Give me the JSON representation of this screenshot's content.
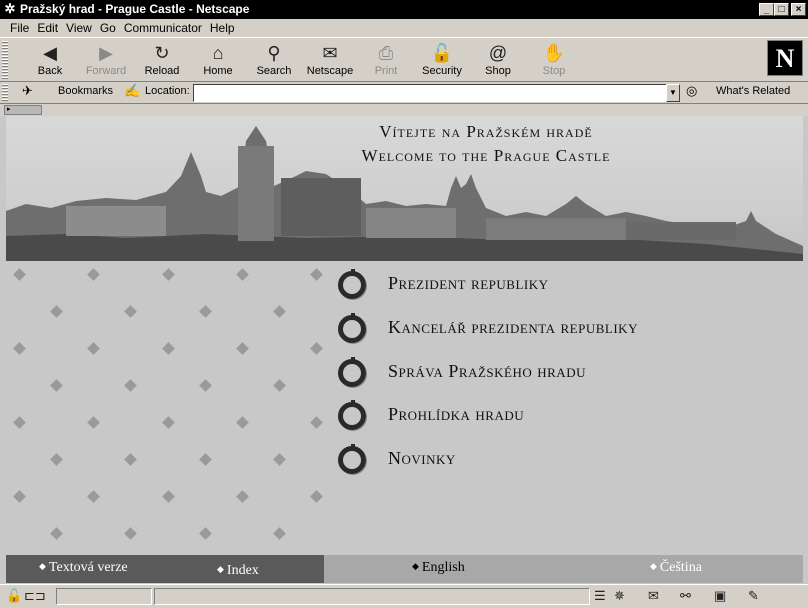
{
  "window": {
    "title": "Pražský hrad - Prague Castle - Netscape",
    "controls": [
      "_",
      "□",
      "×"
    ]
  },
  "menu": [
    "File",
    "Edit",
    "View",
    "Go",
    "Communicator",
    "Help"
  ],
  "toolbar": [
    {
      "label": "Back",
      "icon": "back-icon",
      "glyph": "◀",
      "enabled": true
    },
    {
      "label": "Forward",
      "icon": "forward-icon",
      "glyph": "▶",
      "enabled": false
    },
    {
      "label": "Reload",
      "icon": "reload-icon",
      "glyph": "↻",
      "enabled": true
    },
    {
      "label": "Home",
      "icon": "home-icon",
      "glyph": "⌂",
      "enabled": true
    },
    {
      "label": "Search",
      "icon": "search-icon",
      "glyph": "⚲",
      "enabled": true
    },
    {
      "label": "Netscape",
      "icon": "netscape-icon",
      "glyph": "✉",
      "enabled": true
    },
    {
      "label": "Print",
      "icon": "print-icon",
      "glyph": "⎙",
      "enabled": false
    },
    {
      "label": "Security",
      "icon": "lock-icon",
      "glyph": "🔓",
      "enabled": true
    },
    {
      "label": "Shop",
      "icon": "shop-icon",
      "glyph": "@",
      "enabled": true
    },
    {
      "label": "Stop",
      "icon": "stop-icon",
      "glyph": "✋",
      "enabled": false
    }
  ],
  "locationbar": {
    "bookmarks": "Bookmarks",
    "location_label": "Location:",
    "location_value": "",
    "related": "What's Related"
  },
  "banner": {
    "line1": "Vítejte na Pražském hradě",
    "line2": "Welcome to the Prague Castle"
  },
  "nav": [
    "Prezident republiky",
    "Kancelář prezidenta republiky",
    "Správa Pražského hradu",
    "Prohlídka hradu",
    "Novinky"
  ],
  "footer": {
    "text_version": "Textová verze",
    "index": "Index",
    "english": "English",
    "czech": "Čeština"
  },
  "colors": {
    "titlebar": "#000000",
    "chrome": "#d4d0c8",
    "page": "#c8c8c8",
    "footer_dark": "#5a5a5a",
    "footer_light": "#a8a8a8"
  }
}
